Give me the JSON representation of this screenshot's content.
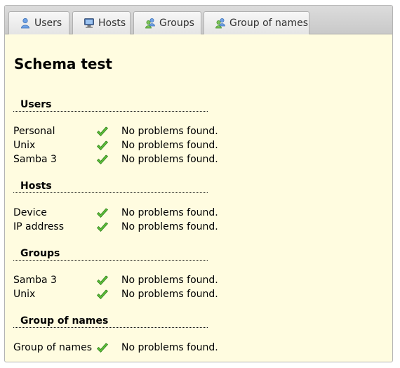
{
  "tabs": [
    {
      "label": "Users",
      "icon": "user-icon"
    },
    {
      "label": "Hosts",
      "icon": "computer-icon"
    },
    {
      "label": "Groups",
      "icon": "group-icon"
    },
    {
      "label": "Group of names",
      "icon": "group-icon"
    }
  ],
  "page_title": "Schema test",
  "sections": [
    {
      "title": "Users",
      "rows": [
        {
          "label": "Personal",
          "status": "No problems found."
        },
        {
          "label": "Unix",
          "status": "No problems found."
        },
        {
          "label": "Samba 3",
          "status": "No problems found."
        }
      ]
    },
    {
      "title": "Hosts",
      "rows": [
        {
          "label": "Device",
          "status": "No problems found."
        },
        {
          "label": "IP address",
          "status": "No problems found."
        }
      ]
    },
    {
      "title": "Groups",
      "rows": [
        {
          "label": "Samba 3",
          "status": "No problems found."
        },
        {
          "label": "Unix",
          "status": "No problems found."
        }
      ]
    },
    {
      "title": "Group of names",
      "rows": [
        {
          "label": "Group of names",
          "status": "No problems found."
        }
      ]
    }
  ],
  "colors": {
    "content_background": "#fffce0",
    "check_green": "#4caf2a"
  }
}
